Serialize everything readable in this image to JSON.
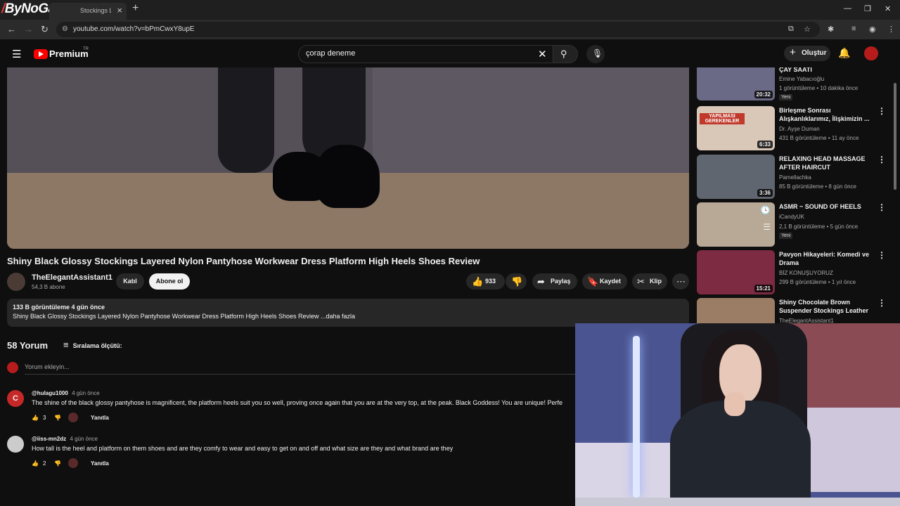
{
  "browser": {
    "brand": "ByNoGame",
    "tab_title": "Stockings La",
    "address": "youtube.com/watch?v=bPmCwxY8upE"
  },
  "header": {
    "logo": "Premium",
    "region": "TR",
    "search_value": "çorap deneme",
    "create_label": "Oluştur"
  },
  "video": {
    "title": "Shiny Black Glossy Stockings Layered Nylon Pantyhose Workwear Dress Platform High Heels Shoes Review",
    "channel": "TheElegantAssistant1",
    "subscribers": "54,3 B abone",
    "join_label": "Katıl",
    "subscribe_label": "Abone ol",
    "likes": "933",
    "share_label": "Paylaş",
    "save_label": "Kaydet",
    "clip_label": "Klip",
    "views_date": "133 B görüntüleme  4 gün önce",
    "description": "Shiny Black Glossy Stockings Layered Nylon Pantyhose Workwear Dress Platform High Heels Shoes Review ...daha fazla"
  },
  "comments": {
    "count_label": "58 Yorum",
    "sort_label": "Sıralama ölçütü:",
    "add_placeholder": "Yorum ekleyin...",
    "items": [
      {
        "avatar_letter": "C",
        "author": "@hulagu1000",
        "age": "4 gün önce",
        "text": "The shine of the black glossy pantyhose is magnificent, the platform heels suit you so well, proving once again that you are at the very top, at the peak. Black Goddess! You are unique! Perfe",
        "likes": "3",
        "reply_label": "Yanıtla"
      },
      {
        "avatar_letter": "",
        "author": "@iiss-mn2dz",
        "age": "4 gün önce",
        "text": "How tall is the heel and platform on them shoes and are they comfy to wear and easy to get on and off and what size are they and what brand are they",
        "likes": "2",
        "reply_label": "Yanıtla"
      }
    ]
  },
  "sidebar": {
    "items": [
      {
        "title": "ÇAY SAATİ",
        "channel": "Emine Yabacıoğlu",
        "meta": "1 görüntüleme • 10 dakika önce",
        "badge": "Yeni",
        "duration": "20:32"
      },
      {
        "title": "Birleşme Sonrası Alışkanlıklarımız, İlişkimizin ...",
        "channel": "Dr. Ayşe Duman",
        "meta": "431 B görüntüleme • 11 ay önce",
        "badge": "",
        "duration": "6:33",
        "thumb_text": "YAPILMASI GEREKENLER"
      },
      {
        "title": "RELAXING HEAD MASSAGE AFTER HAIRCUT #pamellachk...",
        "channel": "Pamellachka",
        "meta": "85 B görüntüleme • 8 gün önce",
        "badge": "",
        "duration": "3:36"
      },
      {
        "title": "ASMR ~ SOUND OF HEELS",
        "channel": "iCandyUK",
        "meta": "2,1 B görüntüleme • 5 gün önce",
        "badge": "Yeni",
        "duration": ""
      },
      {
        "title": "Pavyon Hikayeleri: Komedi ve Drama",
        "channel": "BİZ KONUŞUYORUZ",
        "meta": "299 B görüntüleme • 1 yıl önce",
        "badge": "",
        "duration": "15:21"
      },
      {
        "title": "Shiny Chocolate Brown Suspender Stockings Leather ...",
        "channel": "TheElegantAssistant1",
        "meta": "",
        "badge": "",
        "duration": ""
      }
    ]
  },
  "colors": {
    "background": "#0f0f0f",
    "youtube_red": "#ff0000",
    "chip": "#272727"
  }
}
